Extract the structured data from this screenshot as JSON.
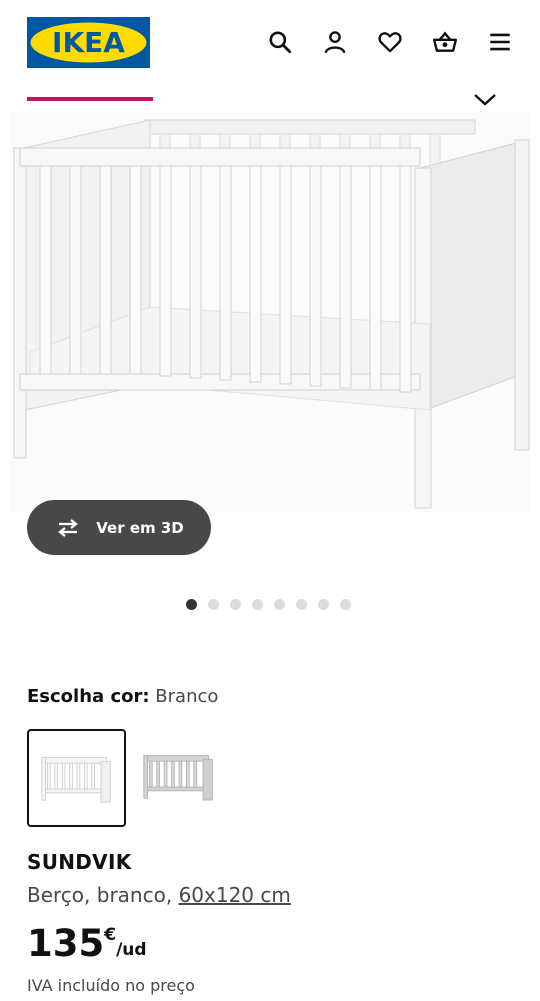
{
  "header": {
    "logo_text": "IKEA",
    "icons": [
      "search-icon",
      "profile-icon",
      "heart-icon",
      "basket-icon",
      "menu-icon"
    ]
  },
  "colors": {
    "accent": "#cc0f5a",
    "logo_blue": "#0058a3",
    "logo_yellow": "#ffdb00",
    "dark_button": "#484848"
  },
  "gallery": {
    "view3d_label": "Ver em 3D",
    "image_count": 8,
    "active_index": 0
  },
  "color_choice": {
    "label": "Escolha cor:",
    "value": "Branco",
    "options": [
      "white-crib-thumbnail",
      "grey-crib-thumbnail"
    ],
    "selected_index": 0
  },
  "product": {
    "name": "SUNDVIK",
    "desc_prefix": "Berço, branco, ",
    "desc_size": "60x120 cm",
    "price_int": "135",
    "currency": "€",
    "unit": "/ud",
    "vat_note": "IVA incluído no preço"
  }
}
